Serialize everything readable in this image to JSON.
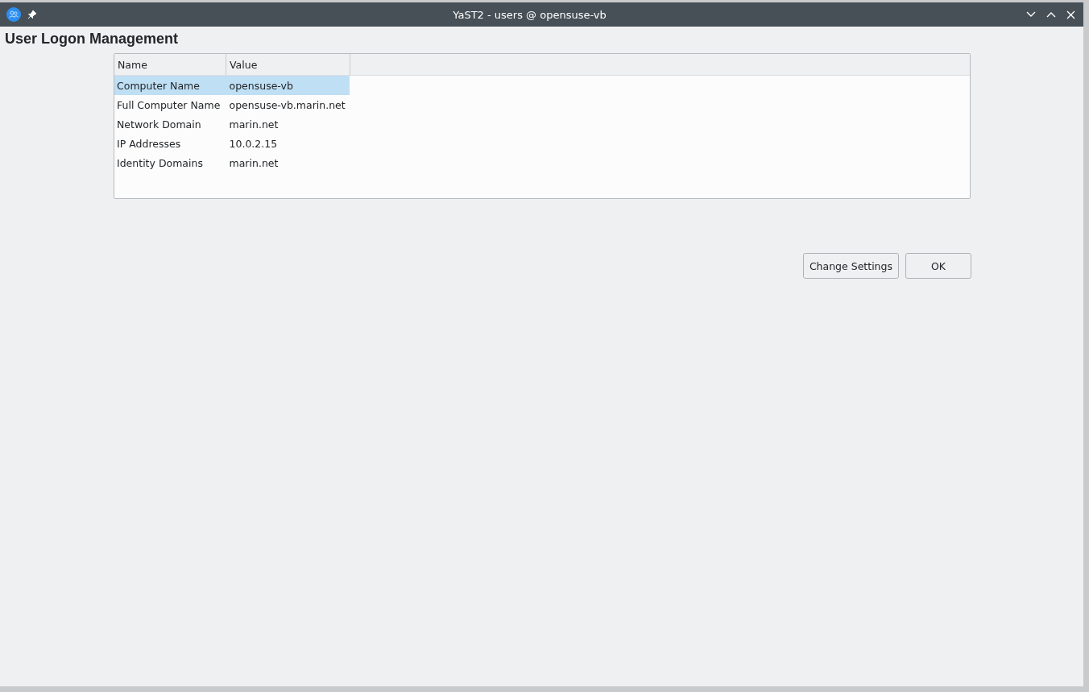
{
  "window": {
    "title": "YaST2 - users @ opensuse-vb"
  },
  "heading": "User Logon Management",
  "table": {
    "columns": [
      "Name",
      "Value"
    ],
    "rows": [
      {
        "name": "Computer Name",
        "value": "opensuse-vb",
        "selected": true
      },
      {
        "name": "Full Computer Name",
        "value": "opensuse-vb.marin.net",
        "selected": false
      },
      {
        "name": "Network Domain",
        "value": "marin.net",
        "selected": false
      },
      {
        "name": "IP Addresses",
        "value": "10.0.2.15",
        "selected": false
      },
      {
        "name": "Identity Domains",
        "value": "marin.net",
        "selected": false
      }
    ]
  },
  "buttons": [
    "Change Settings",
    "OK"
  ]
}
